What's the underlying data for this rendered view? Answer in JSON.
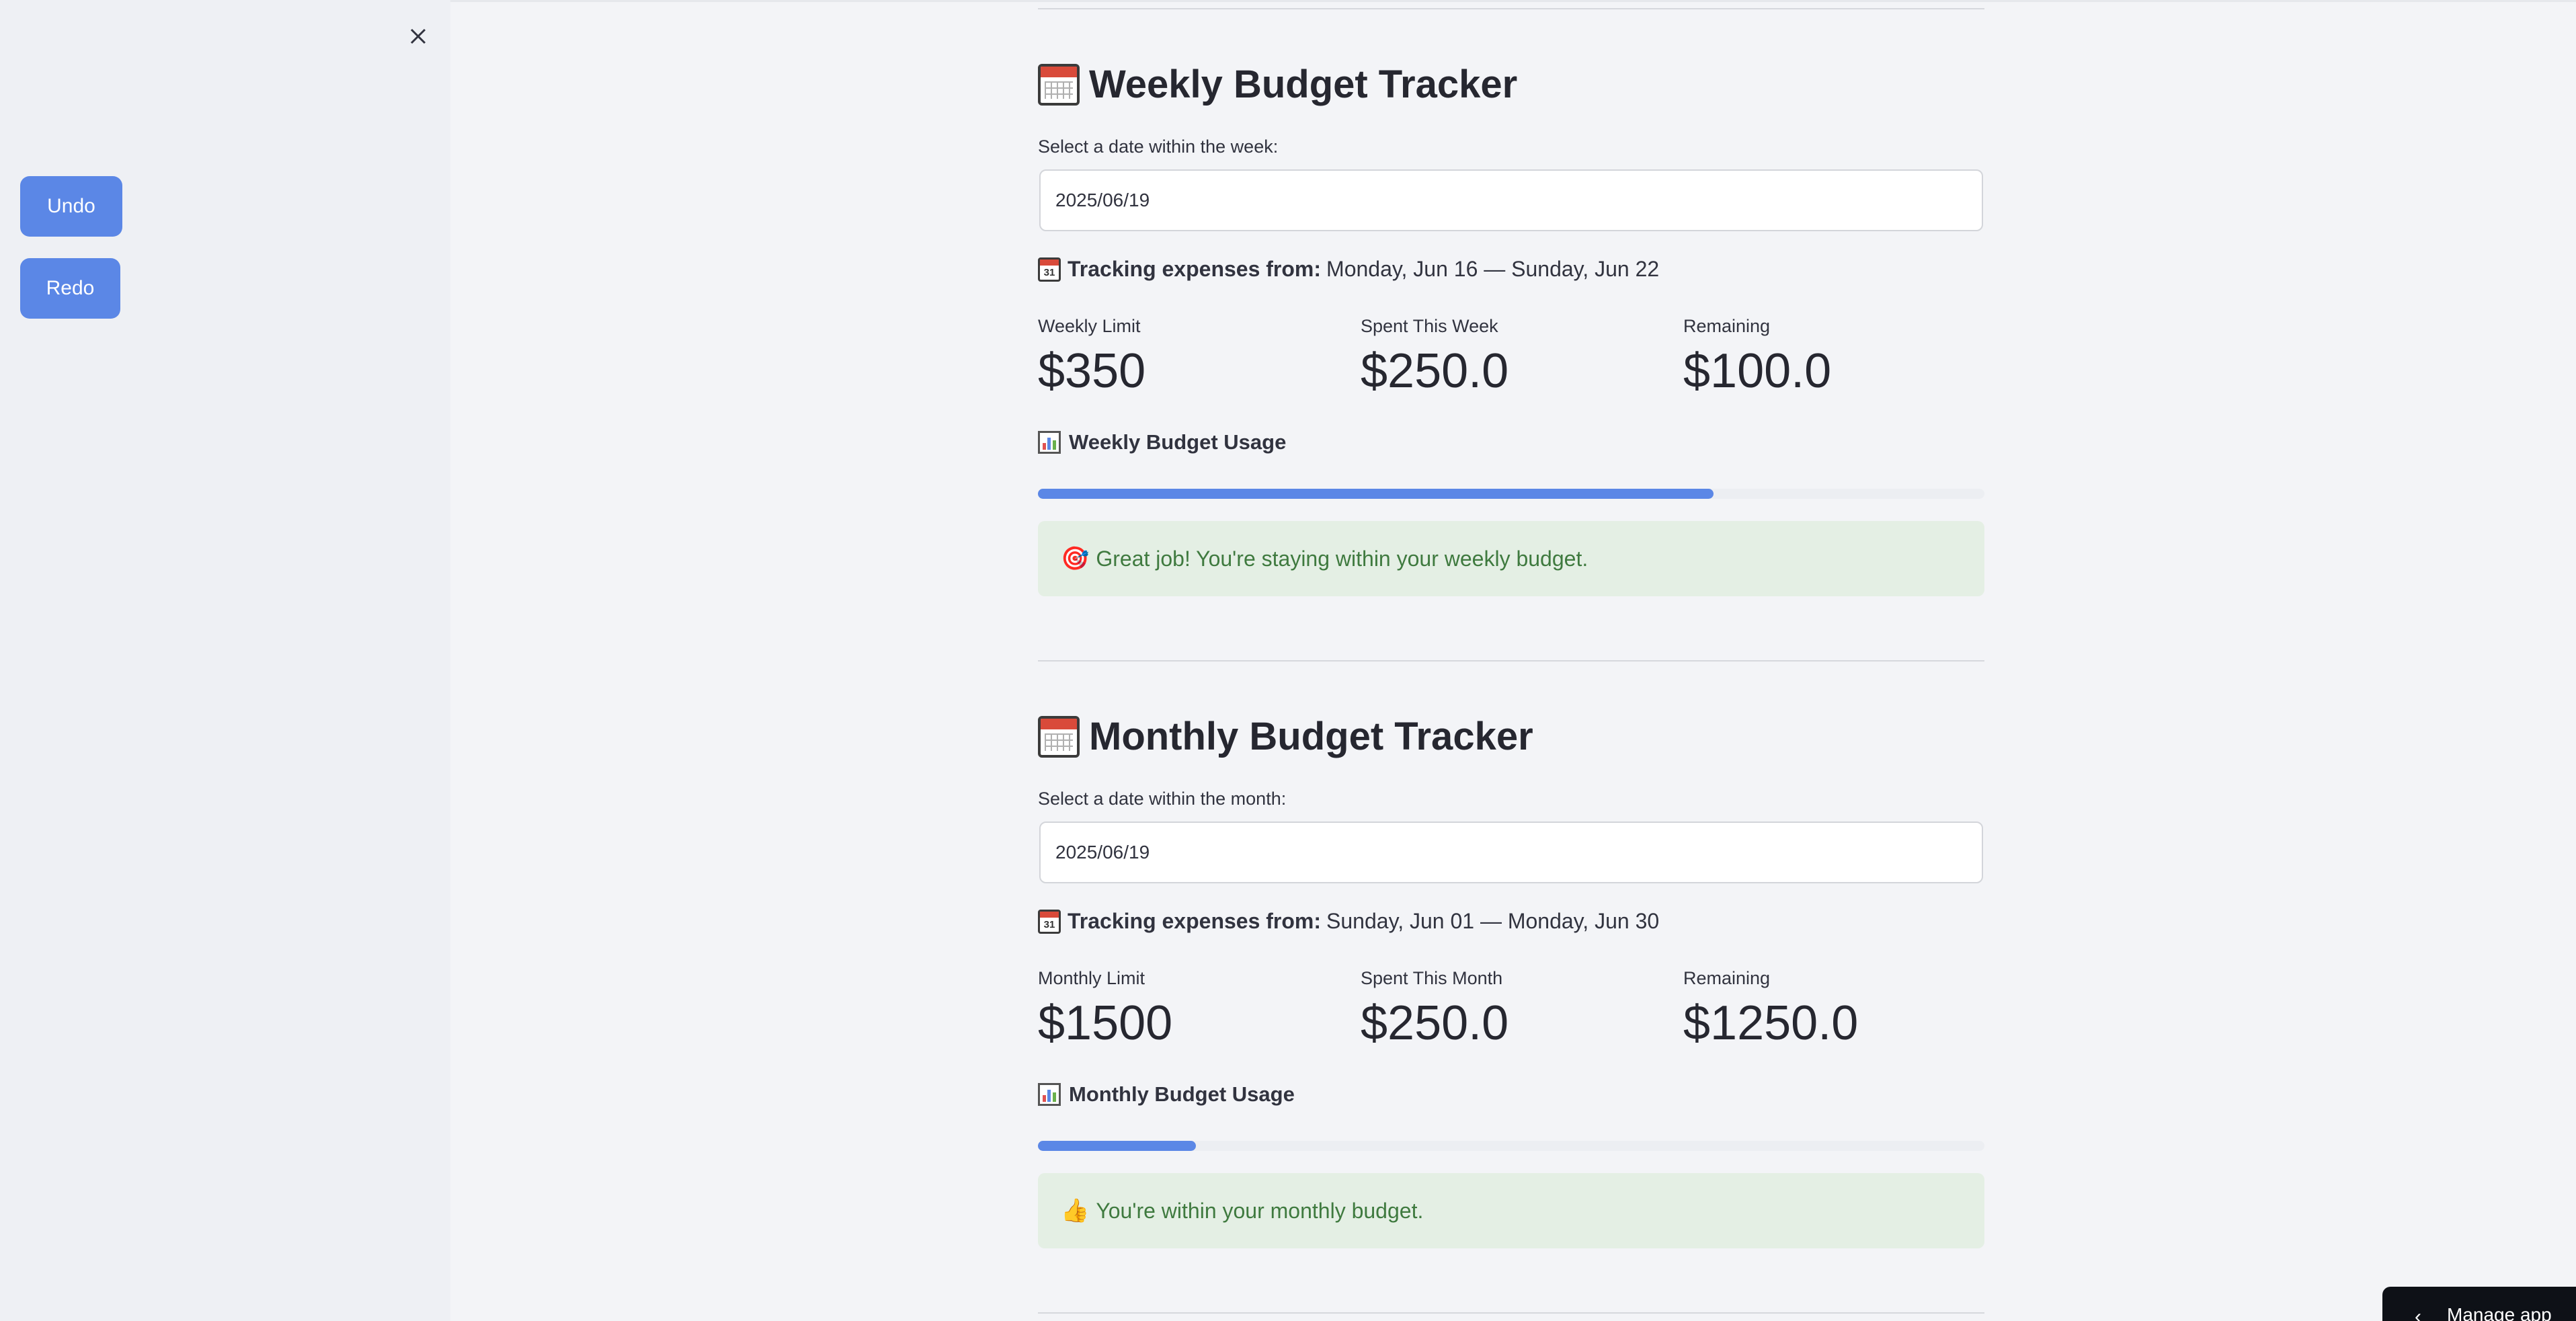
{
  "sidebar": {
    "close_label": "×",
    "undo_label": "Undo",
    "redo_label": "Redo"
  },
  "weekly": {
    "title": "Weekly Budget Tracker",
    "date_label": "Select a date within the week:",
    "date_value": "2025/06/19",
    "tracking_label": "Tracking expenses from:",
    "tracking_range": "Monday, Jun 16 — Sunday, Jun 22",
    "metrics": [
      {
        "label": "Weekly Limit",
        "value": "$350"
      },
      {
        "label": "Spent This Week",
        "value": "$250.0"
      },
      {
        "label": "Remaining",
        "value": "$100.0"
      }
    ],
    "usage_label": "Weekly Budget Usage",
    "usage_fraction": 0.714,
    "alert_emoji": "🎯",
    "alert_text": "Great job! You're staying within your weekly budget."
  },
  "monthly": {
    "title": "Monthly Budget Tracker",
    "date_label": "Select a date within the month:",
    "date_value": "2025/06/19",
    "tracking_label": "Tracking expenses from:",
    "tracking_range": "Sunday, Jun 01 — Monday, Jun 30",
    "metrics": [
      {
        "label": "Monthly Limit",
        "value": "$1500"
      },
      {
        "label": "Spent This Month",
        "value": "$250.0"
      },
      {
        "label": "Remaining",
        "value": "$1250.0"
      }
    ],
    "usage_label": "Monthly Budget Usage",
    "usage_fraction": 0.167,
    "alert_emoji": "👍",
    "alert_text": "You're within your monthly budget."
  },
  "calendar_icon_day": "31",
  "manage_app_label": "Manage app",
  "colors": {
    "accent": "#5b87e6",
    "success_bg": "#e4efe4",
    "success_text": "#3f7a3f"
  }
}
